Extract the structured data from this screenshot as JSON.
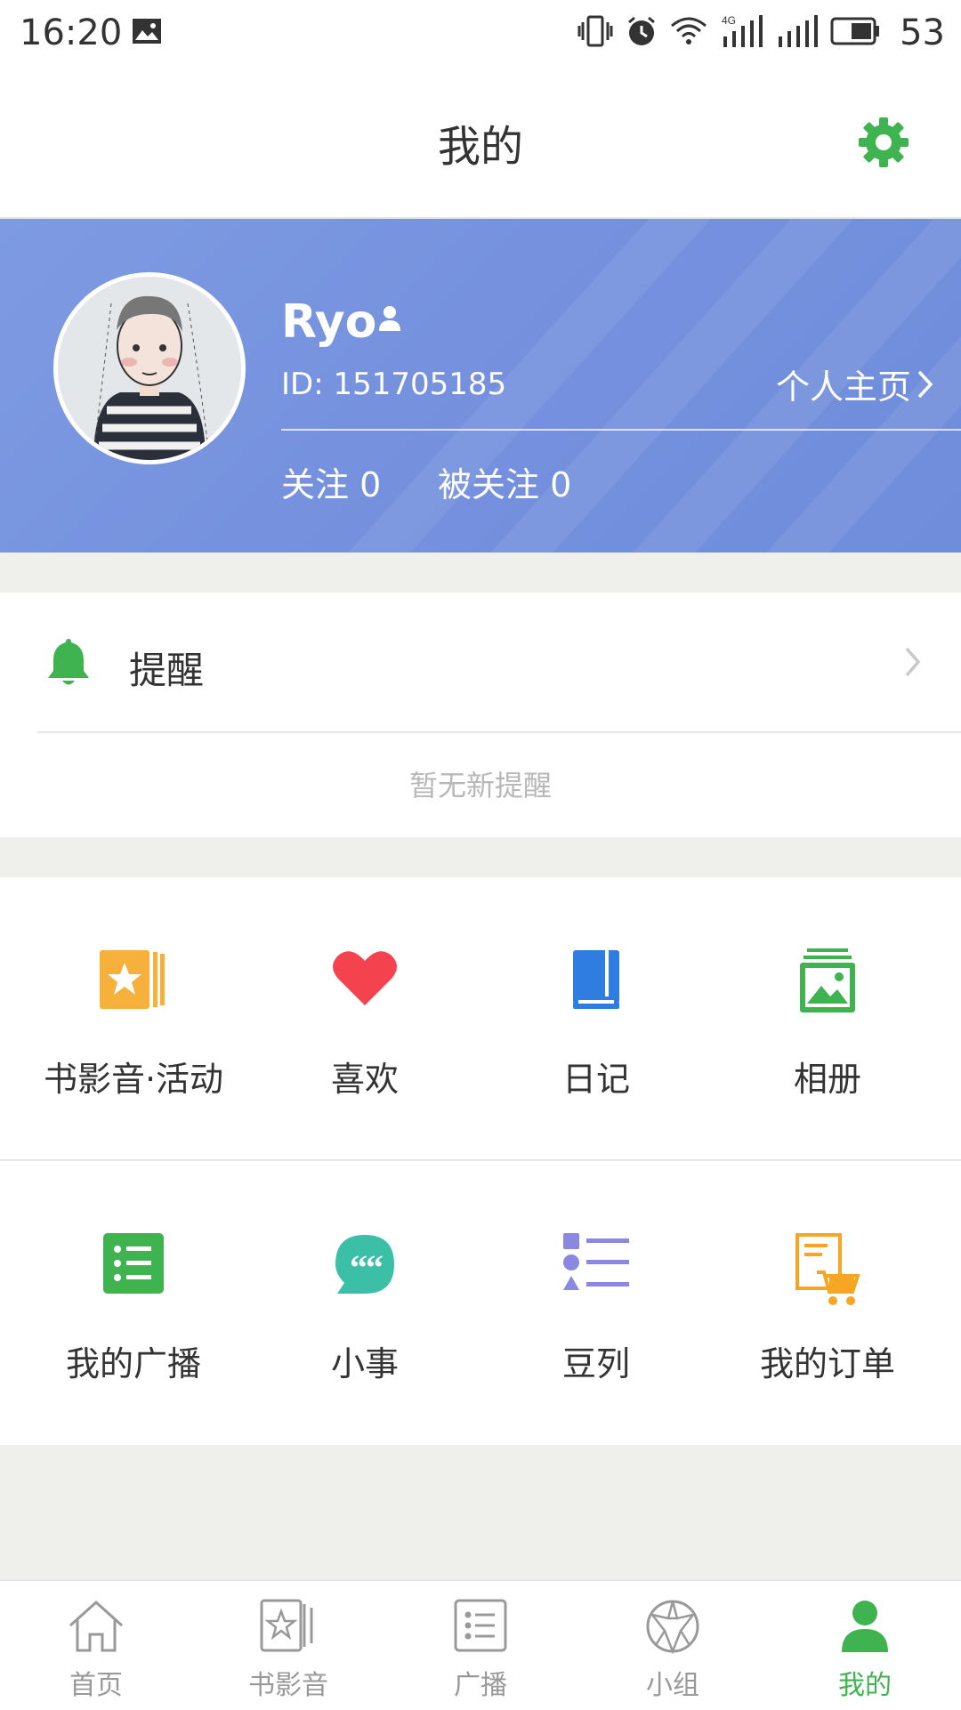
{
  "status_bar": {
    "time": "16:20",
    "battery": "53",
    "icons": [
      "image-icon",
      "vibrate-icon",
      "alarm-icon",
      "wifi-icon",
      "4g-signal-icon",
      "signal-icon",
      "battery-icon"
    ]
  },
  "header": {
    "title": "我的",
    "settings_icon": "gear-icon"
  },
  "profile": {
    "name": "Ryo",
    "id": "ID: 151705185",
    "homepage_label": "个人主页",
    "following": "关注 0",
    "followers": "被关注 0",
    "background_color": "#7591de"
  },
  "reminder": {
    "title": "提醒",
    "empty_text": "暂无新提醒",
    "bell_color": "#3fb34f"
  },
  "grid": {
    "row1": [
      {
        "label": "书影音·活动",
        "icon": "star-card-icon",
        "color": "#f6b13c"
      },
      {
        "label": "喜欢",
        "icon": "heart-icon",
        "color": "#f4434f"
      },
      {
        "label": "日记",
        "icon": "diary-icon",
        "color": "#2f7de0"
      },
      {
        "label": "相册",
        "icon": "album-icon",
        "color": "#3fb34f"
      }
    ],
    "row2": [
      {
        "label": "我的广播",
        "icon": "broadcast-list-icon",
        "color": "#3fb34f"
      },
      {
        "label": "小事",
        "icon": "quote-bubble-icon",
        "color": "#3bbfa7"
      },
      {
        "label": "豆列",
        "icon": "shapes-list-icon",
        "color": "#8a88e0"
      },
      {
        "label": "我的订单",
        "icon": "order-cart-icon",
        "color": "#f6a623"
      }
    ]
  },
  "tabbar": {
    "active_color": "#3fb34f",
    "tabs": [
      {
        "label": "首页",
        "icon": "home-icon"
      },
      {
        "label": "书影音",
        "icon": "book-movie-icon"
      },
      {
        "label": "广播",
        "icon": "broadcast-icon"
      },
      {
        "label": "小组",
        "icon": "group-icon"
      },
      {
        "label": "我的",
        "icon": "person-icon"
      }
    ]
  }
}
